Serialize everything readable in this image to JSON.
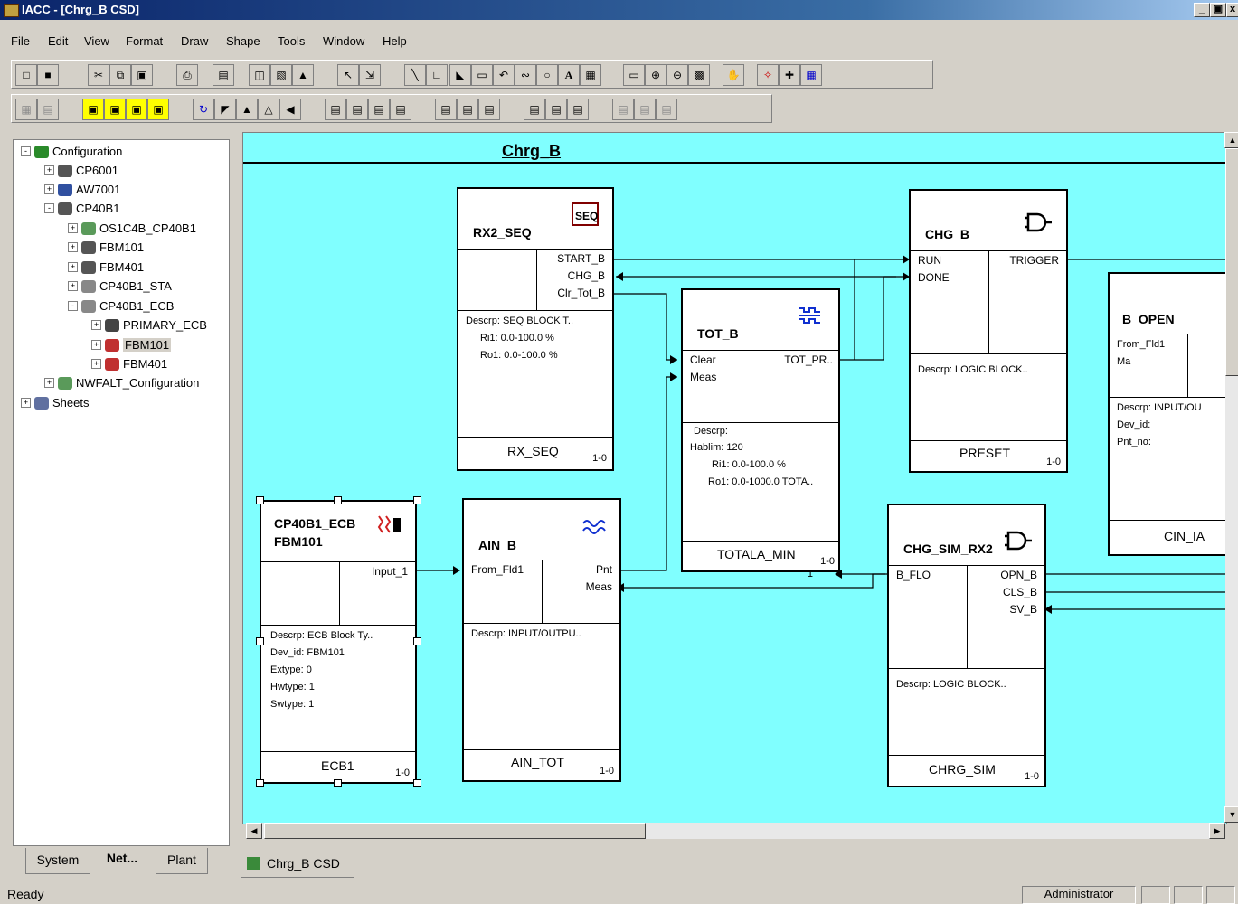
{
  "window": {
    "title": "IACC - [Chrg_B CSD]",
    "buttons": [
      "_",
      "▫",
      "x"
    ]
  },
  "menu": [
    "File",
    "Edit",
    "View",
    "Format",
    "Draw",
    "Shape",
    "Tools",
    "Window",
    "Help"
  ],
  "tree": [
    {
      "label": "Configuration",
      "level": 0,
      "exp": "-",
      "icon": "globe-icon"
    },
    {
      "label": "CP6001",
      "level": 1,
      "exp": "+",
      "icon": "cp-icon"
    },
    {
      "label": "AW7001",
      "level": 1,
      "exp": "+",
      "icon": "workstation-icon"
    },
    {
      "label": "CP40B1",
      "level": 1,
      "exp": "-",
      "icon": "cp-icon"
    },
    {
      "label": "OS1C4B_CP40B1",
      "level": 2,
      "exp": "+",
      "icon": "network-icon"
    },
    {
      "label": "FBM101",
      "level": 2,
      "exp": "+",
      "icon": "fbm-icon"
    },
    {
      "label": "FBM401",
      "level": 2,
      "exp": "+",
      "icon": "fbm-icon"
    },
    {
      "label": "CP40B1_STA",
      "level": 2,
      "exp": "+",
      "icon": "compound-icon"
    },
    {
      "label": "CP40B1_ECB",
      "level": 2,
      "exp": "-",
      "icon": "compound-icon"
    },
    {
      "label": "PRIMARY_ECB",
      "level": 3,
      "exp": "+",
      "icon": "ecb-icon"
    },
    {
      "label": "FBM101",
      "level": 3,
      "exp": "+",
      "icon": "ecb-red-icon",
      "selected": true
    },
    {
      "label": "FBM401",
      "level": 3,
      "exp": "+",
      "icon": "ecb-red-icon"
    },
    {
      "label": "NWFALT_Configuration",
      "level": 1,
      "exp": "+",
      "icon": "network-icon"
    },
    {
      "label": "Sheets",
      "level": 0,
      "exp": "+",
      "icon": "sheets-icon"
    }
  ],
  "left_tabs": [
    "System",
    "Net...",
    "Plant"
  ],
  "canvas": {
    "title": "Chrg_B",
    "blocks": {
      "rx2_seq": {
        "name": "RX2_SEQ",
        "outputs": [
          "START_B",
          "CHG_B",
          "Clr_Tot_B"
        ],
        "descr": [
          "Descrp:  SEQ BLOCK T..",
          "Ri1:  0.0-100.0 %",
          "Ro1:  0.0-100.0 %"
        ],
        "footer": "RX_SEQ",
        "page": "1-0",
        "icon": "seq-block-icon"
      },
      "tot_b": {
        "name": "TOT_B",
        "inputs": [
          "Clear",
          "Meas"
        ],
        "outputs": [
          "TOT_PR.."
        ],
        "descr": [
          "Descrp:",
          "Hablim:  120",
          "Ri1:  0.0-100.0 %",
          "Ro1:  0.0-1000.0 TOTA.."
        ],
        "footer": "TOTALA_MIN",
        "page": "1-0",
        "icon": "totalizer-icon",
        "pin": "1"
      },
      "chg_b": {
        "name": "CHG_B",
        "inputs": [
          "RUN",
          "DONE"
        ],
        "outputs": [
          "TRIGGER"
        ],
        "descr": [
          "Descrp:  LOGIC BLOCK.."
        ],
        "footer": "PRESET",
        "page": "1-0",
        "icon": "logic-gate-icon"
      },
      "b_open": {
        "name": "B_OPEN",
        "inputs": [
          "From_Fld1",
          "Ma"
        ],
        "descr": [
          "Descrp:  INPUT/OU",
          "Dev_id:",
          "Pnt_no:"
        ],
        "footer": "CIN_IA"
      },
      "ecb": {
        "name": "CP40B1_ECB",
        "name2": "FBM101",
        "outputs": [
          "Input_1"
        ],
        "descr": [
          "Descrp:  ECB Block Ty..",
          "Dev_id:  FBM101",
          "Extype:  0",
          "Hwtype:  1",
          "Swtype:  1"
        ],
        "footer": "ECB1",
        "page": "1-0",
        "icon": "ecb-block-icon"
      },
      "ain_b": {
        "name": "AIN_B",
        "inputs": [
          "From_Fld1"
        ],
        "outputs": [
          "Pnt",
          "Meas"
        ],
        "descr": [
          "Descrp:  INPUT/OUTPU.."
        ],
        "footer": "AIN_TOT",
        "page": "1-0",
        "icon": "analog-wave-icon"
      },
      "chg_sim": {
        "name": "CHG_SIM_RX2",
        "inputs": [
          "B_FLO"
        ],
        "outputs": [
          "OPN_B",
          "CLS_B",
          "SV_B"
        ],
        "descr": [
          "Descrp:  LOGIC BLOCK.."
        ],
        "footer": "CHRG_SIM",
        "page": "1-0",
        "icon": "logic-gate-icon"
      }
    }
  },
  "doc_tab": "Chrg_B CSD",
  "status": {
    "text": "Ready",
    "user": "Administrator"
  }
}
